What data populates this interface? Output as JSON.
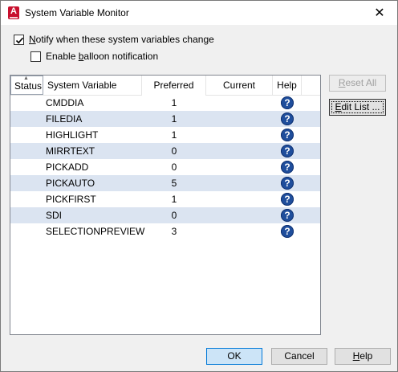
{
  "window": {
    "title": "System Variable Monitor",
    "close_glyph": "✕",
    "app_icon_letter": "A"
  },
  "options": {
    "notify_label_pre": "",
    "notify_label_ul": "N",
    "notify_label_post": "otify when these system variables change",
    "notify_checked": true,
    "balloon_label_pre": "Enable ",
    "balloon_label_ul": "b",
    "balloon_label_post": "alloon notification",
    "balloon_checked": false
  },
  "grid": {
    "columns": {
      "status": "Status",
      "variable": "System Variable",
      "preferred": "Preferred",
      "current": "Current",
      "help": "Help"
    },
    "rows": [
      {
        "variable": "CMDDIA",
        "preferred": "1",
        "current": ""
      },
      {
        "variable": "FILEDIA",
        "preferred": "1",
        "current": ""
      },
      {
        "variable": "HIGHLIGHT",
        "preferred": "1",
        "current": ""
      },
      {
        "variable": "MIRRTEXT",
        "preferred": "0",
        "current": ""
      },
      {
        "variable": "PICKADD",
        "preferred": "0",
        "current": ""
      },
      {
        "variable": "PICKAUTO",
        "preferred": "5",
        "current": ""
      },
      {
        "variable": "PICKFIRST",
        "preferred": "1",
        "current": ""
      },
      {
        "variable": "SDI",
        "preferred": "0",
        "current": ""
      },
      {
        "variable": "SELECTIONPREVIEW",
        "preferred": "3",
        "current": ""
      }
    ],
    "help_glyph": "?"
  },
  "buttons": {
    "reset_all_ul": "R",
    "reset_all_rest": "eset All",
    "edit_list_ul": "E",
    "edit_list_rest": "dit List ...",
    "ok": "OK",
    "cancel": "Cancel",
    "help_ul": "H",
    "help_rest": "elp"
  },
  "colors": {
    "alt_row": "#dbe4f1",
    "help_icon": "#1f4e9c",
    "default_button_border": "#0078d7",
    "app_icon": "#c8102e"
  }
}
